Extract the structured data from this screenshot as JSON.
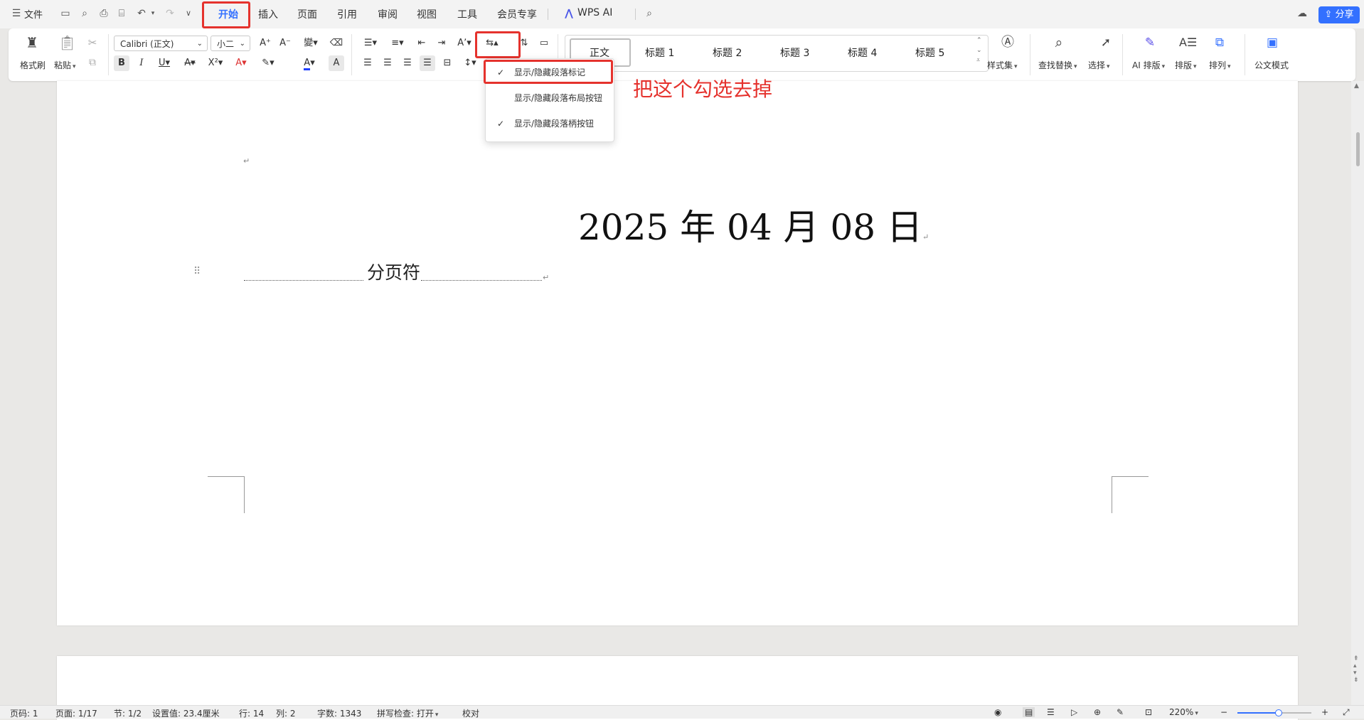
{
  "menubar": {
    "file_label": "文件",
    "tabs": [
      "开始",
      "插入",
      "页面",
      "引用",
      "审阅",
      "视图",
      "工具",
      "会员专享"
    ],
    "active_tab": "开始",
    "wps_ai": "WPS AI",
    "share": "分享"
  },
  "ribbon": {
    "format_painter": "格式刷",
    "paste": "粘贴",
    "font_name": "Calibri (正文)",
    "font_size": "小二",
    "styles": [
      "正文",
      "标题 1",
      "标题 2",
      "标题 3",
      "标题 4",
      "标题 5"
    ],
    "style_set": "样式集",
    "find_replace": "查找替换",
    "select": "选择",
    "ai_layout": "AI 排版",
    "layout": "排版",
    "arrange": "排列",
    "official_mode": "公文模式",
    "font_color": "#1f3fff"
  },
  "dropdown": {
    "items": [
      {
        "label": "显示/隐藏段落标记",
        "checked": "✓"
      },
      {
        "label": "显示/隐藏段落布局按钮",
        "checked": ""
      },
      {
        "label": "显示/隐藏段落柄按钮",
        "checked": "✓"
      }
    ]
  },
  "annotation": "把这个勾选去掉",
  "document": {
    "date_line": "2025 年 04 月 08 日",
    "page_break_label": "分页符",
    "para_mark": "↵"
  },
  "status": {
    "page_no": "页码: 1",
    "pages": "页面: 1/17",
    "section": "节: 1/2",
    "setting": "设置值: 23.4厘米",
    "row": "行: 14",
    "col": "列: 2",
    "words": "字数: 1343",
    "spellcheck": "拼写检查: 打开",
    "proof": "校对",
    "zoom": "220%",
    "zoom_fraction": 0.55
  },
  "colors": {
    "accent": "#3370ff",
    "highlight_red": "#e5322d"
  }
}
